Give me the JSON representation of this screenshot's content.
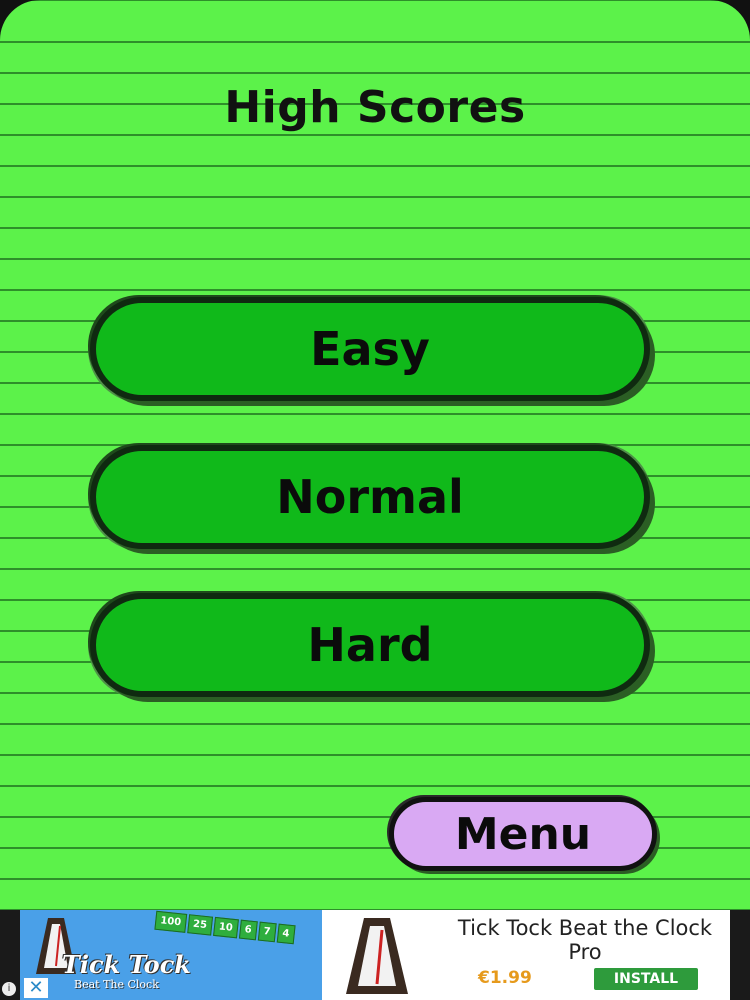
{
  "screen": {
    "title": "High Scores",
    "background_color": "#5cf24a",
    "line_color": "#2e8f2a"
  },
  "difficulty_buttons": [
    {
      "label": "Easy"
    },
    {
      "label": "Normal"
    },
    {
      "label": "Hard"
    }
  ],
  "menu_button": {
    "label": "Menu",
    "color": "#d9a9f3"
  },
  "ad": {
    "tiles": [
      "100",
      "25",
      "10",
      "6",
      "7",
      "4"
    ],
    "logo_text": "Tick Tock",
    "logo_sub": "Beat The Clock",
    "title": "Tick Tock Beat the Clock Pro",
    "price": "€1.99",
    "install_label": "INSTALL",
    "info_icon": "info-icon",
    "close_icon": "close-icon"
  }
}
